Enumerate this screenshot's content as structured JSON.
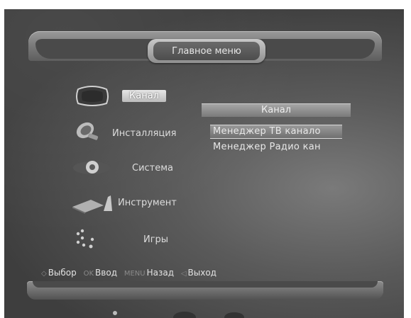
{
  "window": {
    "title": "Главное меню"
  },
  "main_menu": {
    "items": [
      {
        "label": "Канал",
        "icon": "tv-icon",
        "selected": true
      },
      {
        "label": "Инсталляция",
        "icon": "satellite-dish-icon",
        "selected": false
      },
      {
        "label": "Система",
        "icon": "system-icon",
        "selected": false
      },
      {
        "label": "Инструмент",
        "icon": "tools-icon",
        "selected": false
      },
      {
        "label": "Игры",
        "icon": "games-icon",
        "selected": false
      }
    ]
  },
  "submenu": {
    "title": "Канал",
    "items": [
      {
        "label": "Менеджер ТВ канало",
        "selected": true
      },
      {
        "label": "Менеджер Радио кан",
        "selected": false
      }
    ]
  },
  "footer": {
    "hints": [
      {
        "key": "◇",
        "label": "Выбор"
      },
      {
        "key": "OK",
        "label": "Ввод"
      },
      {
        "key": "MENU",
        "label": "Назад"
      },
      {
        "key": "◁",
        "label": "Выход"
      }
    ]
  }
}
